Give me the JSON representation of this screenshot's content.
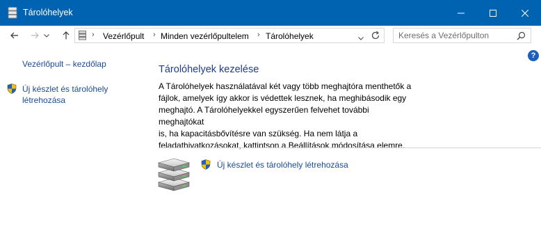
{
  "window": {
    "title": "Tárolóhelyek",
    "accent": "#0063b1"
  },
  "navigation": {
    "breadcrumbs": [
      "Vezérlőpult",
      "Minden vezérlőpultelem",
      "Tárolóhelyek"
    ],
    "search_placeholder": "Keresés a Vezérlőpulton"
  },
  "sidebar": {
    "home_link": "Vezérlőpult – kezdőlap",
    "create_link_line1": "Új készlet és tárolóhely",
    "create_link_line2": "létrehozása"
  },
  "main": {
    "heading": "Tárolóhelyek kezelése",
    "description_lines": [
      "A Tárolóhelyek használatával két vagy több meghajtóra menthetők a",
      "fájlok, amelyek így akkor is védettek lesznek, ha meghibásodik egy",
      "meghajtó. A Tárolóhelyekkel egyszerűen felvehet további meghajtókat",
      "is, ha kapacitásbővítésre van szükség. Ha nem látja a",
      "feladathivatkozásokat, kattintson a Beállítások módosítása elemre."
    ],
    "create_link": "Új készlet és tárolóhely létrehozása"
  },
  "icons": {
    "title": "storage-spaces-icon",
    "back": "arrow-left-icon",
    "forward": "arrow-right-icon",
    "recent": "chevron-down-icon",
    "up": "arrow-up-icon",
    "refresh": "refresh-icon",
    "search": "search-icon",
    "help": "help-icon",
    "uac": "uac-shield-icon",
    "drives": "stacked-drives-icon"
  }
}
